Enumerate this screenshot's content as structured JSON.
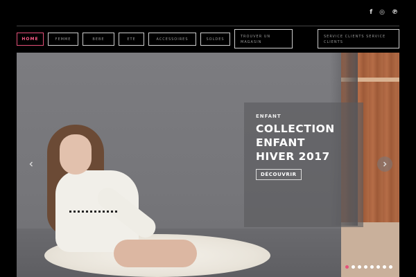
{
  "social": [
    {
      "name": "facebook-icon",
      "glyph": "f"
    },
    {
      "name": "instagram-icon",
      "glyph": "◎"
    },
    {
      "name": "pinterest-icon",
      "glyph": "℗"
    }
  ],
  "nav": {
    "items": [
      {
        "label": "HOME",
        "active": true
      },
      {
        "label": "FEMME",
        "active": false
      },
      {
        "label": "BEBE",
        "active": false
      },
      {
        "label": "ETE",
        "active": false
      },
      {
        "label": "ACCESSOIRES",
        "active": false
      },
      {
        "label": "SOLDES",
        "active": false
      },
      {
        "label": "TROUVER UN MAGASIN",
        "active": false
      },
      {
        "label": "SERVICE CLIENTS SERVICE CLIENTS",
        "active": false
      }
    ]
  },
  "hero": {
    "kicker": "ENFANT",
    "title_lines": [
      "COLLECTION",
      "ENFANT",
      "HIVER 2017"
    ],
    "cta": "DÉCOUVRIR",
    "slides_count": 8,
    "active_slide": 1,
    "accent_color": "#e4517a"
  }
}
